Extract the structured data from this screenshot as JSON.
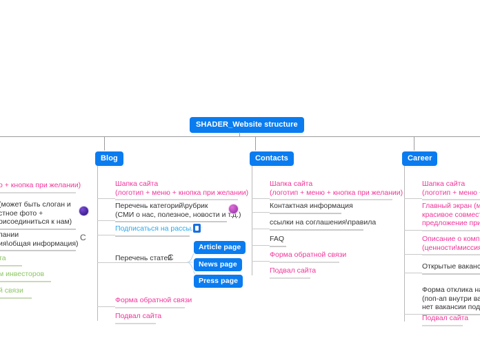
{
  "root": {
    "label": "SHADER_Website structure"
  },
  "palette": {
    "node_blue": "#0a7cf0",
    "pink": "#f0349a",
    "cyan": "#29a8ea",
    "green": "#8cc663",
    "dark": "#333333",
    "line": "#9a9a9a",
    "badge_purple": "#3b1d8c",
    "badge_pink": "#9c3bb0"
  },
  "branches": [
    {
      "id": "clipped-left",
      "label": "",
      "clipped": true,
      "topics": [
        {
          "lines": [
            "о + кнопка при желании)"
          ],
          "color": "pink",
          "marker": null
        },
        {
          "lines": [
            "(может быть слоган и",
            "стное фото +",
            "рисоединиться к нам)"
          ],
          "color": "dark",
          "marker": "badge-purple"
        },
        {
          "lines": [
            "пании",
            "ия\\общая информация)"
          ],
          "color": "dark",
          "marker": "c-marker"
        },
        {
          "lines": [
            "та"
          ],
          "color": "green",
          "marker": null
        },
        {
          "lines": [
            "м инвесторов"
          ],
          "color": "green",
          "marker": null
        },
        {
          "lines": [
            "й связи"
          ],
          "color": "green",
          "marker": null
        }
      ]
    },
    {
      "id": "blog",
      "label": "Blog",
      "clipped": false,
      "topics": [
        {
          "lines": [
            "Шапка сайта",
            "(логотип + меню + кнопка при желании)"
          ],
          "color": "pink",
          "marker": null
        },
        {
          "lines": [
            "Перечень категорий\\рубрик",
            "(СМИ о нас, полезное, новости и т.д.)"
          ],
          "color": "dark",
          "marker": "badge-pink"
        },
        {
          "lines": [
            "Подписаться на рассылку"
          ],
          "color": "cyan",
          "marker": "sq-icon"
        },
        {
          "lines": [
            "Перечень статей"
          ],
          "color": "dark",
          "marker": "c-marker",
          "children": [
            "Article page",
            "News page",
            "Press page"
          ]
        },
        {
          "lines": [
            "Форма обратной связи"
          ],
          "color": "pink",
          "marker": null
        },
        {
          "lines": [
            "Подвал сайта"
          ],
          "color": "pink",
          "marker": null
        }
      ]
    },
    {
      "id": "contacts",
      "label": "Contacts",
      "clipped": false,
      "topics": [
        {
          "lines": [
            "Шапка сайта",
            "(логотип + меню + кнопка при желании)"
          ],
          "color": "pink",
          "marker": null
        },
        {
          "lines": [
            "Контактная информация"
          ],
          "color": "dark",
          "marker": null
        },
        {
          "lines": [
            "ссылки на соглашения\\правила"
          ],
          "color": "dark",
          "marker": null
        },
        {
          "lines": [
            "FAQ"
          ],
          "color": "dark",
          "marker": null
        },
        {
          "lines": [
            "Форма обратной связи"
          ],
          "color": "pink",
          "marker": null
        },
        {
          "lines": [
            "Подвал сайта"
          ],
          "color": "pink",
          "marker": null
        }
      ]
    },
    {
      "id": "career",
      "label": "Career",
      "clipped": true,
      "topics": [
        {
          "lines": [
            "Шапка сайта",
            "(логотип + меню + к"
          ],
          "color": "pink",
          "marker": null
        },
        {
          "lines": [
            "Главный экран (мож",
            "красивое совместно",
            "предложение присо"
          ],
          "color": "pink",
          "marker": null
        },
        {
          "lines": [
            "Описание о компани",
            "(ценности\\миссия\\о"
          ],
          "color": "pink",
          "marker": null
        },
        {
          "lines": [
            "Открытые вакансии"
          ],
          "color": "dark",
          "marker": null
        },
        {
          "lines": [
            "Форма отклика на в",
            "(поп-ап внутри вака",
            "нет вакансии подхо"
          ],
          "color": "dark",
          "marker": null
        },
        {
          "lines": [
            "Подвал сайта"
          ],
          "color": "pink",
          "marker": null
        }
      ]
    }
  ]
}
